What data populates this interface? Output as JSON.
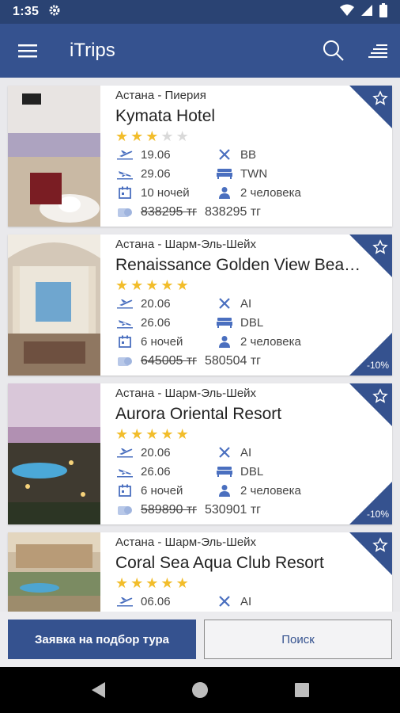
{
  "status_bar": {
    "time": "1:35"
  },
  "app_bar": {
    "title": "iTrips"
  },
  "tours": [
    {
      "route": "Астана - Пиерия",
      "hotel": "Kymata Hotel",
      "stars": 3,
      "depart": "19.06",
      "return": "29.06",
      "nights": "10 ночей",
      "meal": "BB",
      "room": "TWN",
      "people": "2 человека",
      "old_price": "838295 тг",
      "price": "838295 тг",
      "discount": ""
    },
    {
      "route": "Астана - Шарм-Эль-Шейх",
      "hotel": "Renaissance Golden View Bea…",
      "stars": 5,
      "depart": "20.06",
      "return": "26.06",
      "nights": "6 ночей",
      "meal": "AI",
      "room": "DBL",
      "people": "2 человека",
      "old_price": "645005 тг",
      "price": "580504 тг",
      "discount": "-10%"
    },
    {
      "route": "Астана - Шарм-Эль-Шейх",
      "hotel": "Aurora Oriental Resort",
      "stars": 5,
      "depart": "20.06",
      "return": "26.06",
      "nights": "6 ночей",
      "meal": "AI",
      "room": "DBL",
      "people": "2 человека",
      "old_price": "589890 тг",
      "price": "530901 тг",
      "discount": "-10%"
    },
    {
      "route": "Астана - Шарм-Эль-Шейх",
      "hotel": "Coral Sea Aqua Club Resort",
      "stars": 5,
      "depart": "06.06",
      "return": "",
      "nights": "",
      "meal": "AI",
      "room": "",
      "people": "",
      "old_price": "",
      "price": "",
      "discount": ""
    }
  ],
  "buttons": {
    "request_tour": "Заявка на подбор тура",
    "search": "Поиск"
  },
  "colors": {
    "primary": "#35528f",
    "status_bar": "#2a4373",
    "star": "#f2bd2b",
    "icon": "#4a6fbf"
  }
}
